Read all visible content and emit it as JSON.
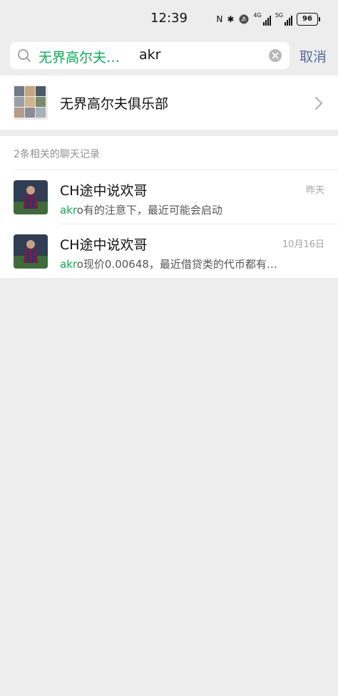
{
  "status_bar": {
    "time": "12:39",
    "nfc_glyph": "N",
    "bluetooth_glyph": "✱",
    "mute_glyph": "🔕",
    "signal1_label": "4G",
    "signal2_label": "5G",
    "battery": "96"
  },
  "search": {
    "keyword_tag": "无界高尔夫…",
    "query": "akr",
    "cancel_label": "取消"
  },
  "group_result": {
    "name": "无界高尔夫俱乐部",
    "avatar_tile_colors": [
      "#6f7b8a",
      "#c7a57a",
      "#4c5a63",
      "#9aa0a7",
      "#d2b48c",
      "#7a8a6e",
      "#b59c8a",
      "#8c8c9c",
      "#a8b0b8"
    ]
  },
  "chat_records": {
    "header": "2条相关的聊天记录",
    "items": [
      {
        "name": "CH途中说欢哥",
        "time": "昨天",
        "snippet_highlight": "akr",
        "snippet_rest": "o有的注意下，最近可能会启动"
      },
      {
        "name": "CH途中说欢哥",
        "time": "10月16日",
        "snippet_highlight": "akr",
        "snippet_rest": "o现价0.00648，最近借贷类的代币都有…"
      }
    ]
  },
  "colors": {
    "highlight_green": "#06ad56",
    "link_blue": "#576b95",
    "page_background": "#ededed"
  }
}
